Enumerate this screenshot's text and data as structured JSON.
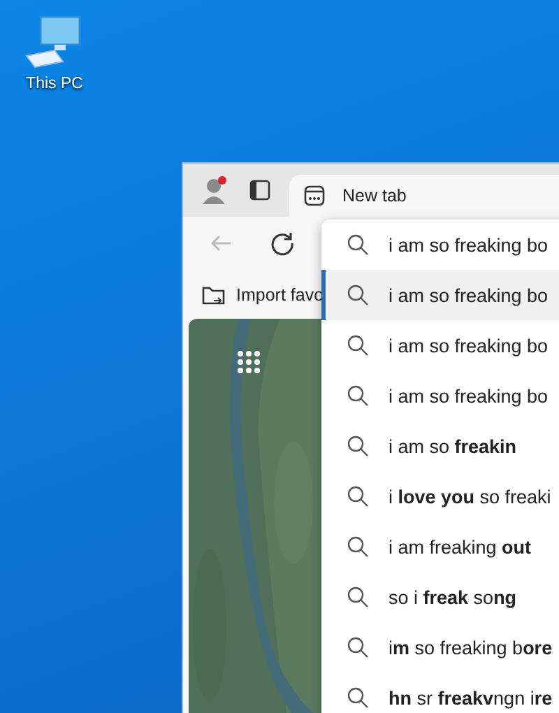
{
  "desktop_icons": [
    {
      "label": "This PC"
    }
  ],
  "browser": {
    "tabs": [
      {
        "label": "New tab",
        "selected": true
      }
    ],
    "bookmarks": [
      {
        "label": "Import favo"
      }
    ],
    "address_box": {
      "value": "i am so freaking bo"
    },
    "suggestions": [
      {
        "text": "i am so freaking bo",
        "selected": true
      },
      {
        "text": "i am so freaking bo",
        "selected": false
      },
      {
        "text": "i am so freaking bo",
        "selected": false
      },
      {
        "text": "i am so **freakin**",
        "selected": false
      },
      {
        "text": "i **love you** so freaki",
        "selected": false
      },
      {
        "text": "i am freaking **out**",
        "selected": false
      },
      {
        "text": "so i **freak** so**ng**",
        "selected": false
      },
      {
        "text": "i**m** so freaking b**ore**",
        "selected": false
      },
      {
        "text": "**hn** sr **freakv**ngn i**re**",
        "selected": false
      }
    ]
  }
}
